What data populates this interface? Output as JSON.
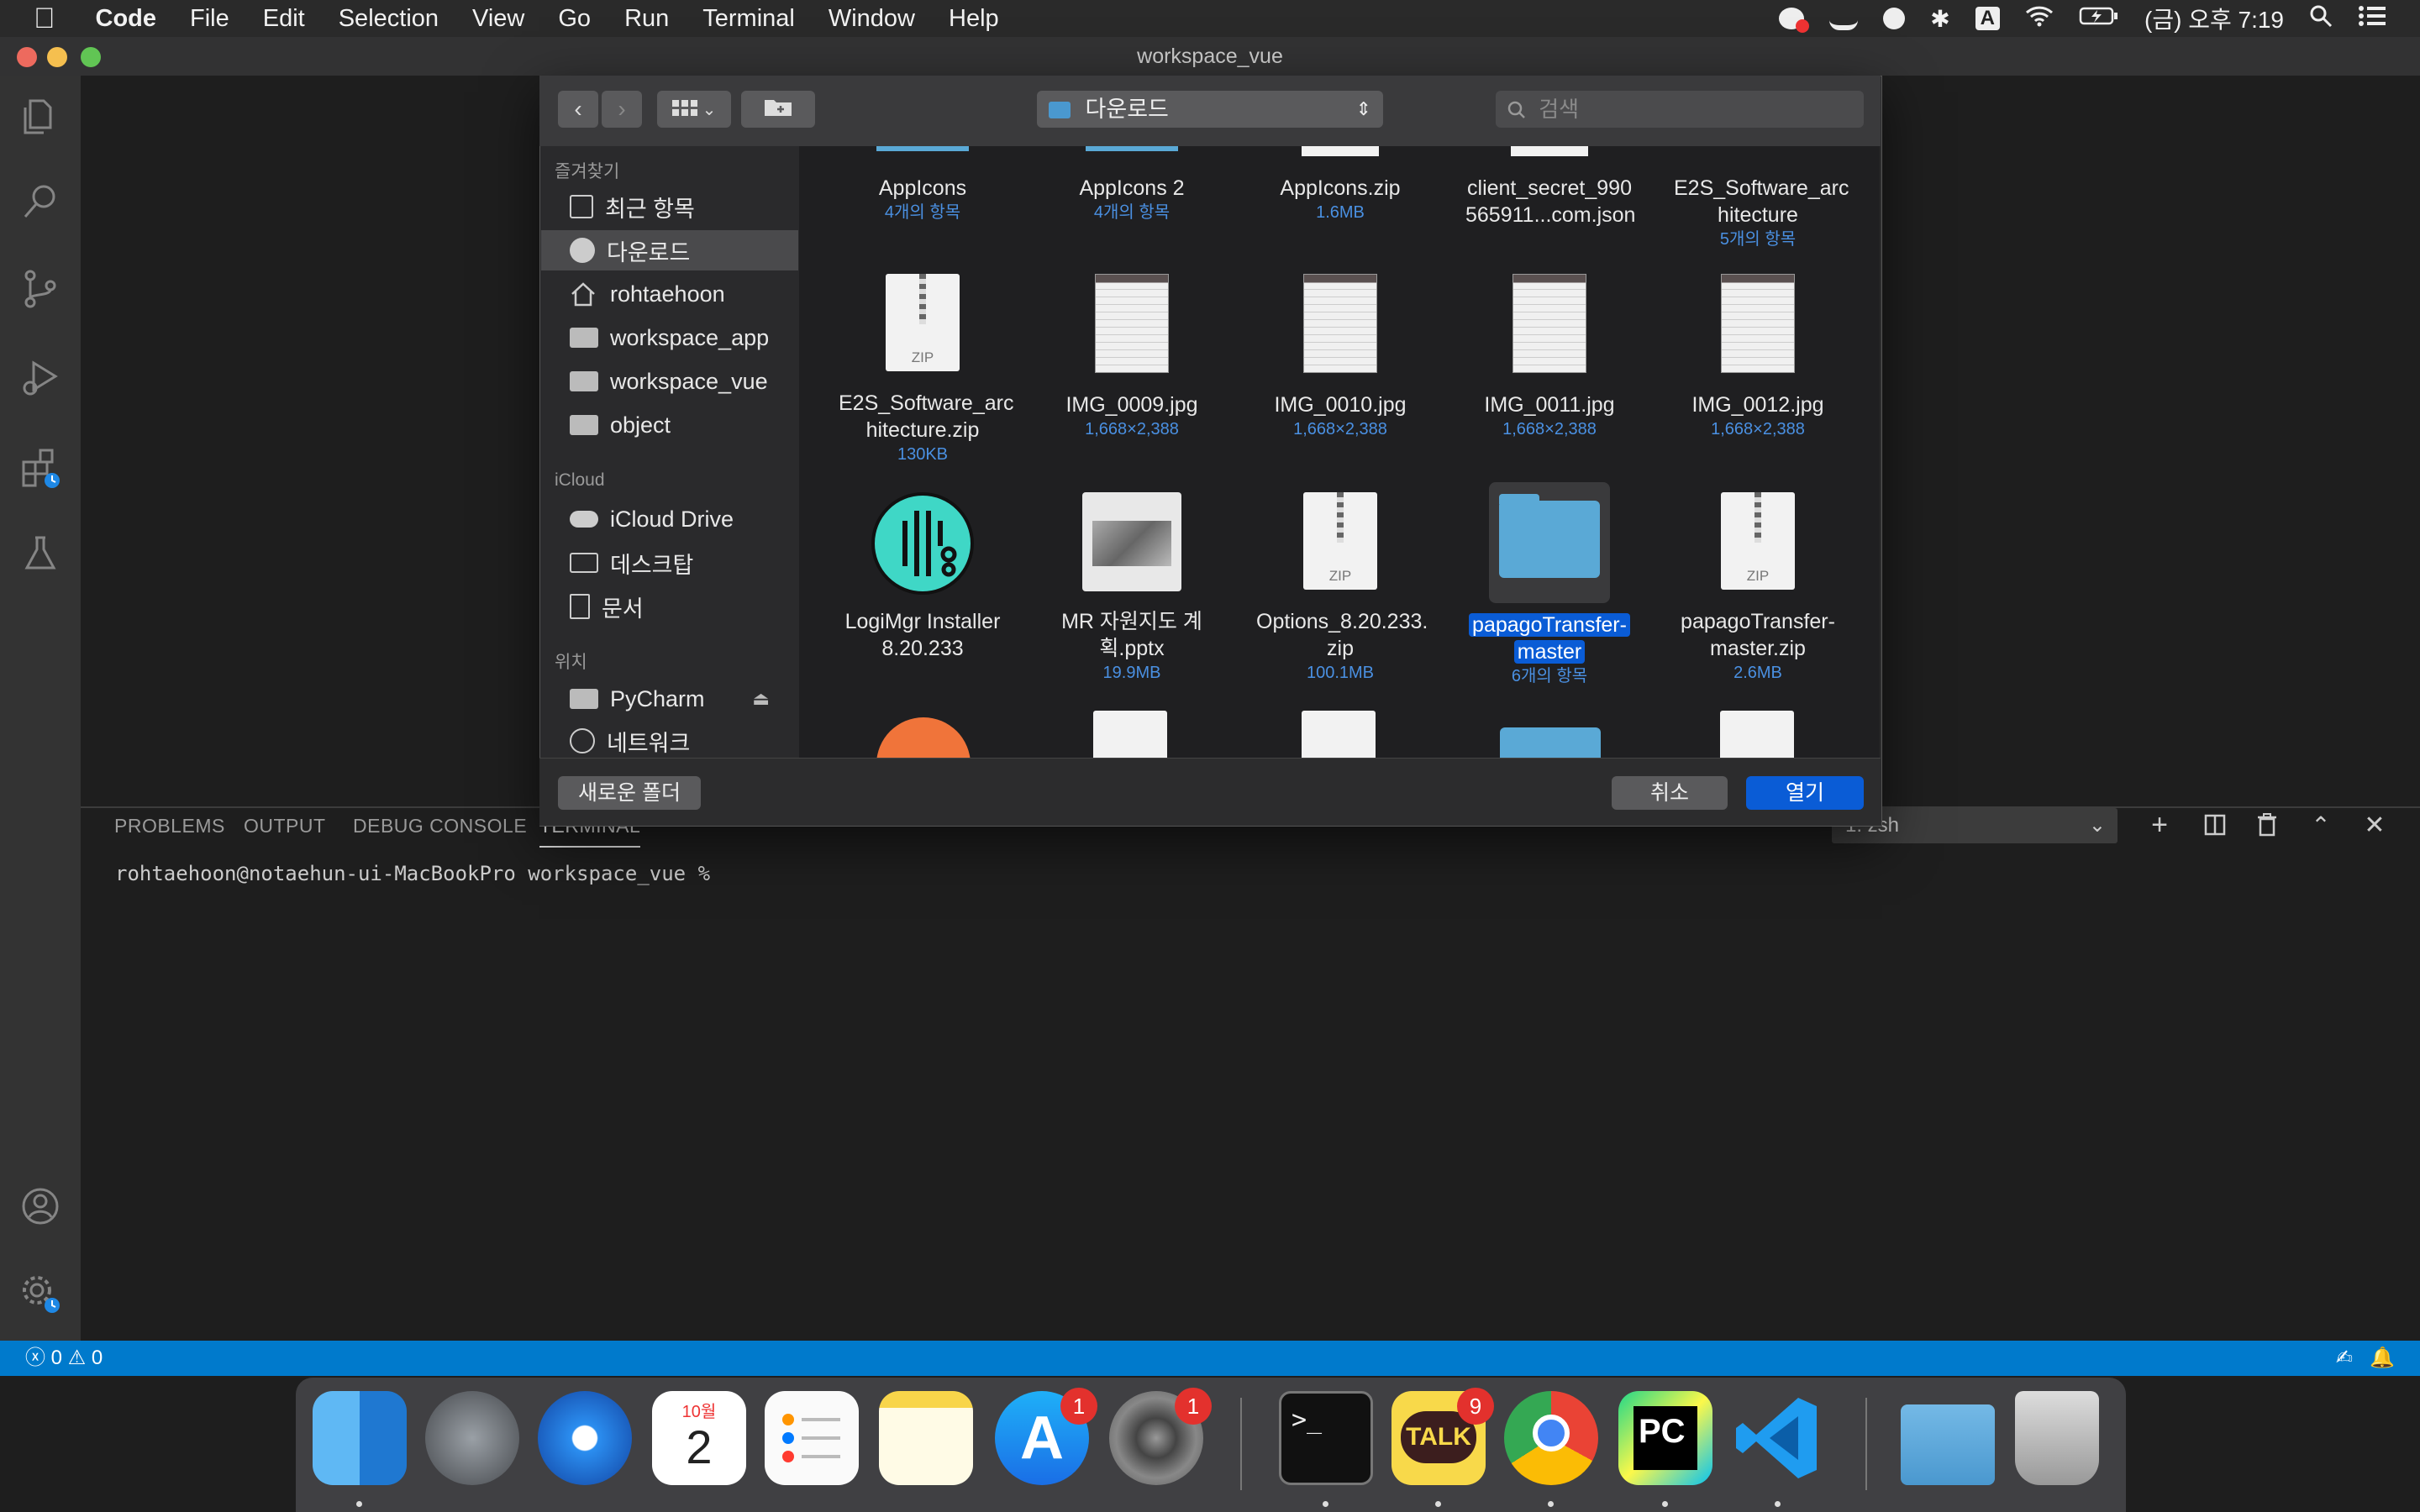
{
  "menubar": {
    "app_name": "Code",
    "items": [
      "File",
      "Edit",
      "Selection",
      "View",
      "Go",
      "Run",
      "Terminal",
      "Window",
      "Help"
    ],
    "clock": "(금) 오후 7:19",
    "input_source": "A"
  },
  "window": {
    "title": "workspace_vue"
  },
  "dialog": {
    "location": "다운로드",
    "search_placeholder": "검색",
    "sidebar": {
      "favorites_header": "즐겨찾기",
      "favorites": [
        "최근 항목",
        "다운로드",
        "rohtaehoon",
        "workspace_app",
        "workspace_vue",
        "object"
      ],
      "icloud_header": "iCloud",
      "icloud": [
        "iCloud Drive",
        "데스크탑",
        "문서"
      ],
      "locations_header": "위치",
      "locations": [
        "PyCharm",
        "네트워크"
      ]
    },
    "files": [
      {
        "name1": "AppIcons",
        "name2": "",
        "sub": "4개의 항목"
      },
      {
        "name1": "AppIcons 2",
        "name2": "",
        "sub": "4개의 항목"
      },
      {
        "name1": "AppIcons.zip",
        "name2": "",
        "sub": "1.6MB"
      },
      {
        "name1": "client_secret_990",
        "name2": "565911...com.json",
        "sub": ""
      },
      {
        "name1": "E2S_Software_arc",
        "name2": "hitecture",
        "sub": "5개의 항목"
      },
      {
        "name1": "E2S_Software_arc",
        "name2": "hitecture.zip",
        "sub": "130KB"
      },
      {
        "name1": "IMG_0009.jpg",
        "name2": "",
        "sub": "1,668×2,388"
      },
      {
        "name1": "IMG_0010.jpg",
        "name2": "",
        "sub": "1,668×2,388"
      },
      {
        "name1": "IMG_0011.jpg",
        "name2": "",
        "sub": "1,668×2,388"
      },
      {
        "name1": "IMG_0012.jpg",
        "name2": "",
        "sub": "1,668×2,388"
      },
      {
        "name1": "LogiMgr Installer",
        "name2": "8.20.233",
        "sub": ""
      },
      {
        "name1": "MR 자원지도 계",
        "name2": "획.pptx",
        "sub": "19.9MB"
      },
      {
        "name1": "Options_8.20.233.",
        "name2": "zip",
        "sub": "100.1MB"
      },
      {
        "name1": "papagoTransfer-",
        "name2": "master",
        "sub": "6개의 항목"
      },
      {
        "name1": "papagoTransfer-",
        "name2": "master.zip",
        "sub": "2.6MB"
      }
    ],
    "zip_label": "ZIP",
    "new_folder_label": "새로운 폴더",
    "cancel_label": "취소",
    "open_label": "열기"
  },
  "panel": {
    "tabs": [
      "PROBLEMS",
      "OUTPUT",
      "DEBUG CONSOLE",
      "TERMINAL"
    ],
    "terminal_select": "1: zsh",
    "prompt": "rohtaehoon@notaehun-ui-MacBookPro workspace_vue %"
  },
  "statusbar": {
    "errors": "0",
    "warnings": "0"
  },
  "dock": {
    "calendar_month": "10월",
    "calendar_day": "2",
    "badges": {
      "appstore": "1",
      "prefs": "1",
      "kakao": "9"
    },
    "kakao_label": "TALK",
    "pycharm_label": "PC"
  },
  "colors": {
    "accent": "#007acc",
    "selection": "#0a5cd6",
    "folder": "#5aa9d6"
  }
}
